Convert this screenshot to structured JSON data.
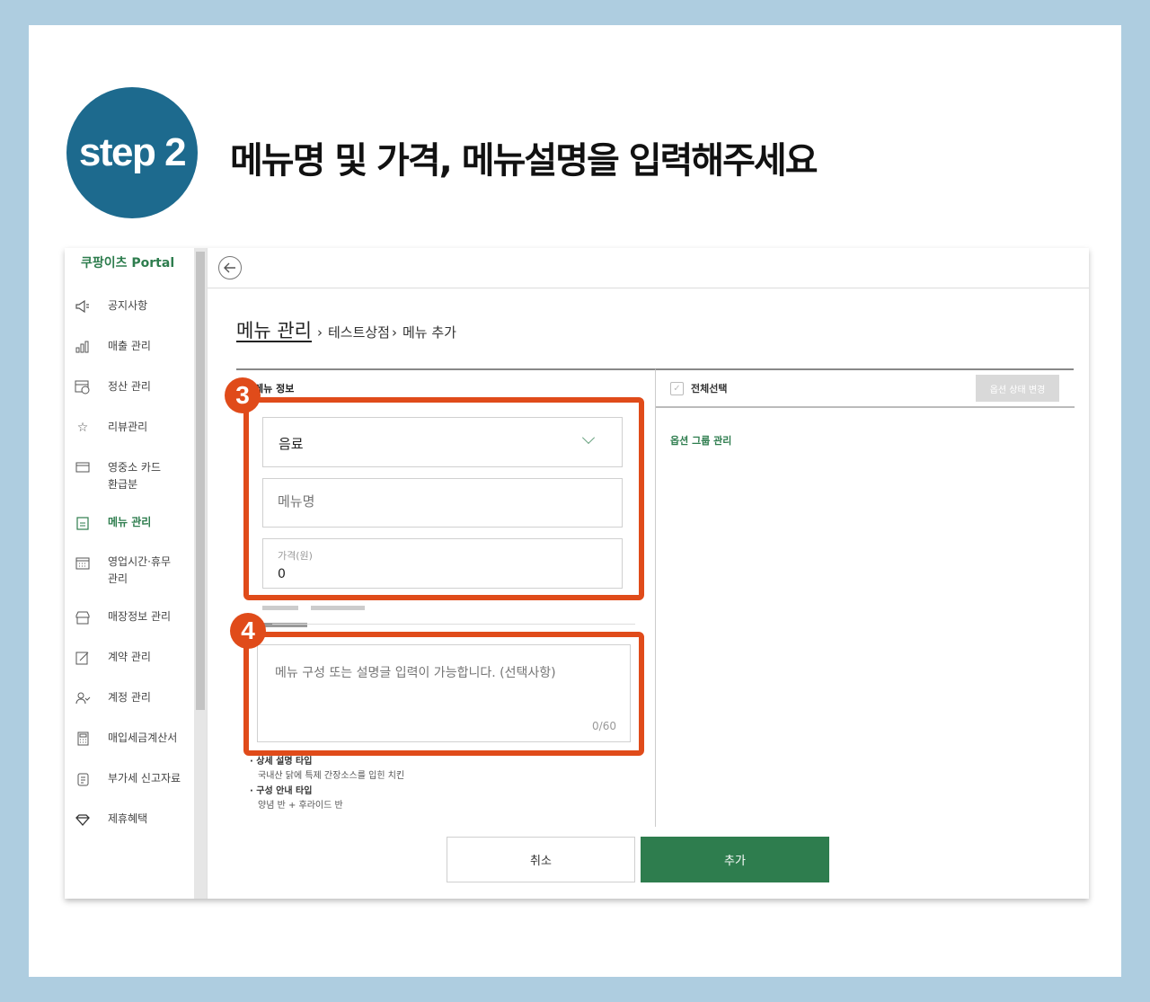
{
  "header": {
    "step_label": "step 2",
    "headline": "메뉴명 및 가격, 메뉴설명을 입력해주세요"
  },
  "sidebar": {
    "logo": "쿠팡이츠 Portal",
    "items": [
      {
        "label": "공지사항",
        "icon": "megaphone-icon"
      },
      {
        "label": "매출 관리",
        "icon": "bar-chart-icon"
      },
      {
        "label": "정산 관리",
        "icon": "won-card-icon"
      },
      {
        "label": "리뷰관리",
        "icon": "star-search-icon"
      },
      {
        "label": "영중소 카드\n환급분",
        "icon": "card-refund-icon"
      },
      {
        "label": "메뉴 관리",
        "icon": "menu-clipboard-icon",
        "active": true
      },
      {
        "label": "영업시간·휴무\n관리",
        "icon": "calendar-icon"
      },
      {
        "label": "매장정보 관리",
        "icon": "store-icon"
      },
      {
        "label": "계약 관리",
        "icon": "contract-icon"
      },
      {
        "label": "계정 관리",
        "icon": "user-check-icon"
      },
      {
        "label": "매입세금계산서",
        "icon": "calculator-icon"
      },
      {
        "label": "부가세 신고자료",
        "icon": "document-icon"
      },
      {
        "label": "제휴혜택",
        "icon": "diamond-icon"
      }
    ]
  },
  "breadcrumb": {
    "main": "메뉴 관리",
    "sep": "›",
    "store": "테스트상점",
    "sep2": "›",
    "current": "메뉴 추가"
  },
  "menu_info": {
    "title": "메뉴 정보",
    "category_value": "음료",
    "name_placeholder": "메뉴명",
    "price_caption": "가격(원)",
    "price_value": "0",
    "desc_placeholder": "메뉴 구성 또는 설명글 입력이 가능합니다. (선택사항)",
    "desc_counter": "0/60",
    "tips": [
      {
        "title": "상세 설명 타입",
        "example": "국내산 닭에 특제 간장소스를 입힌 치킨"
      },
      {
        "title": "구성 안내 타입",
        "example": "양념 반 + 후라이드 반"
      }
    ]
  },
  "options": {
    "select_all": "전체선택",
    "state_change": "옵션 상태 변경",
    "group_manage": "옵션 그룹 관리"
  },
  "actions": {
    "cancel": "취소",
    "add": "추가"
  },
  "annotations": {
    "marker_3": "3",
    "marker_4": "4"
  },
  "colors": {
    "brand_green": "#2e7d4e",
    "badge_blue": "#1d6a8e",
    "highlight_orange": "#e04b1a",
    "frame_blue": "#aecde0"
  }
}
